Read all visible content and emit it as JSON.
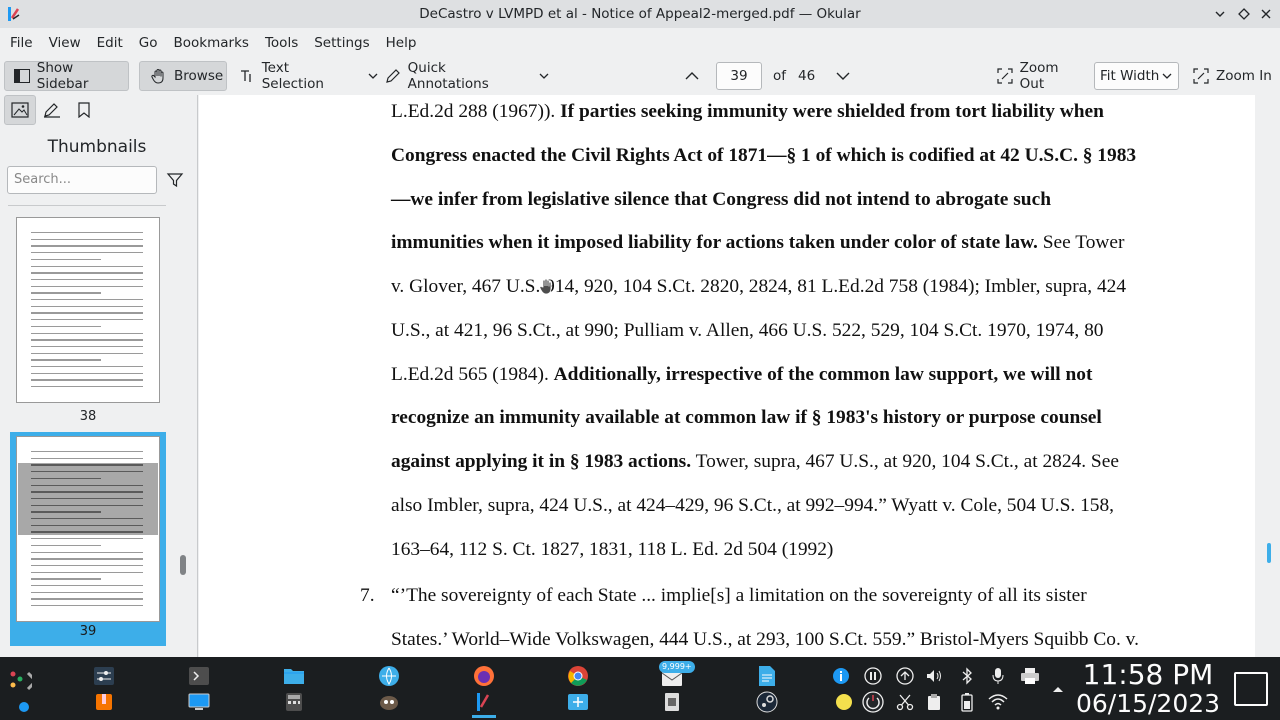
{
  "window": {
    "title": "DeCastro v LVMPD et al - Notice of Appeal2-merged.pdf — Okular"
  },
  "menubar": [
    "File",
    "View",
    "Edit",
    "Go",
    "Bookmarks",
    "Tools",
    "Settings",
    "Help"
  ],
  "toolbar": {
    "show_sidebar": "Show Sidebar",
    "browse": "Browse",
    "text_selection": "Text Selection",
    "quick_annotations": "Quick Annotations",
    "page_current": "39",
    "page_of": "of",
    "page_total": "46",
    "zoom_out": "Zoom Out",
    "zoom_mode": "Fit Width",
    "zoom_in": "Zoom In"
  },
  "sidebar": {
    "heading": "Thumbnails",
    "search_placeholder": "Search...",
    "thumbnails": [
      {
        "label": "38",
        "selected": false
      },
      {
        "label": "39",
        "selected": true
      }
    ]
  },
  "document": {
    "lines": [
      {
        "parts": [
          {
            "t": "L.Ed.2d 288 (1967)). ",
            "b": false
          },
          {
            "t": "If parties seeking immunity were shielded from tort liability when",
            "b": true
          }
        ]
      },
      {
        "parts": [
          {
            "t": "Congress enacted the Civil Rights Act of 1871—§ 1 of which is codified at 42 U.S.C. § 1983",
            "b": true
          }
        ]
      },
      {
        "parts": [
          {
            "t": "—we infer from legislative silence that Congress did not intend to abrogate such",
            "b": true
          }
        ]
      },
      {
        "parts": [
          {
            "t": "immunities when it imposed liability for actions taken under color of state law.",
            "b": true
          },
          {
            "t": " See Tower",
            "b": false
          }
        ]
      },
      {
        "parts": [
          {
            "t": "v. Glover, 467 U.S. 914, 920, 104 S.Ct. 2820, 2824, 81 L.Ed.2d 758 (1984); Imbler, supra, 424",
            "b": false
          }
        ]
      },
      {
        "parts": [
          {
            "t": "U.S., at 421, 96 S.Ct., at 990; Pulliam v. Allen, 466 U.S. 522, 529, 104 S.Ct. 1970, 1974, 80",
            "b": false
          }
        ]
      },
      {
        "parts": [
          {
            "t": "L.Ed.2d 565 (1984). ",
            "b": false
          },
          {
            "t": "Additionally, irrespective of the common law support, we will not",
            "b": true
          }
        ]
      },
      {
        "parts": [
          {
            "t": "recognize an immunity available at common law if § 1983's history or purpose counsel",
            "b": true
          }
        ]
      },
      {
        "parts": [
          {
            "t": "against applying it in § 1983 actions.",
            "b": true
          },
          {
            "t": " Tower, supra, 467 U.S., at 920, 104 S.Ct., at 2824. See",
            "b": false
          }
        ]
      },
      {
        "parts": [
          {
            "t": "also Imbler, supra, 424 U.S., at 424–429, 96 S.Ct., at 992–994.” Wyatt v. Cole, 504 U.S. 158,",
            "b": false
          }
        ]
      },
      {
        "parts": [
          {
            "t": "163–64, 112 S. Ct. 1827, 1831, 118 L. Ed. 2d 504 (1992)",
            "b": false
          }
        ]
      }
    ],
    "footnote_number": "7.",
    "footnote_lines": [
      "“’The sovereignty of each State ... implie[s] a limitation on the sovereignty of all its sister",
      "States.’ World–Wide Volkswagen, 444 U.S., at 293, 100 S.Ct. 559.” Bristol-Myers Squibb Co. v."
    ]
  },
  "taskbar": {
    "mail_badge": "9,999+",
    "time": "11:58 PM",
    "date": "06/15/2023"
  },
  "colors": {
    "accent": "#3daee9",
    "panel": "#eff0f1",
    "taskbar": "#1b1e20"
  }
}
